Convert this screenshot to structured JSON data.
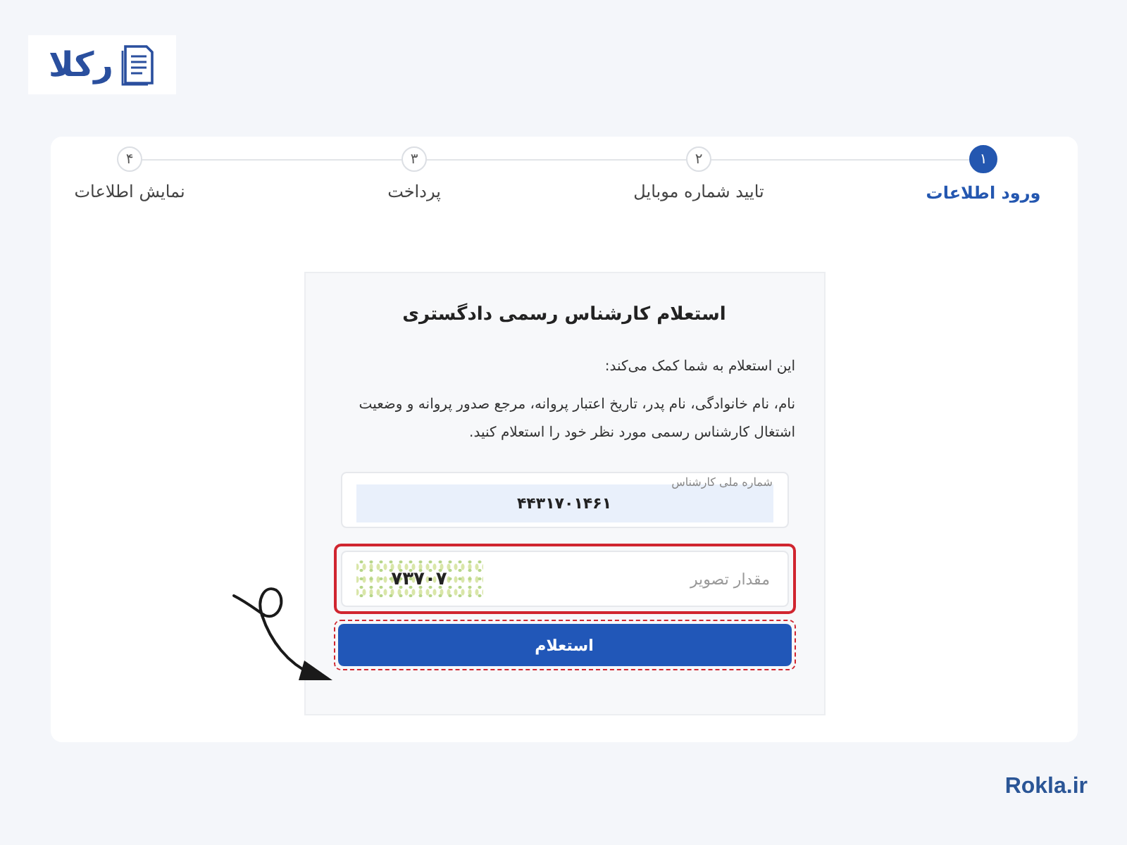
{
  "logo": {
    "text": "رکلا"
  },
  "steps": [
    {
      "number": "۱",
      "label": "ورود اطلاعات",
      "selected": true
    },
    {
      "number": "۲",
      "label": "تایید شماره موبایل",
      "selected": false
    },
    {
      "number": "۳",
      "label": "پرداخت",
      "selected": false
    },
    {
      "number": "۴",
      "label": "نمایش اطلاعات",
      "selected": false
    }
  ],
  "form": {
    "title": "استعلام کارشناس رسمی دادگستری",
    "intro": "این استعلام به شما کمک می‌کند:",
    "description": "نام، نام خانوادگی، نام پدر، تاریخ اعتبار پروانه، مرجع صدور پروانه و وضعیت اشتغال کارشناس رسمی مورد نظر خود را استعلام کنید.",
    "fields": [
      {
        "kind": "text",
        "label": "شماره ملی کارشناس",
        "value": "۴۴۳۱۷۰۱۴۶۱",
        "highlighted": false
      },
      {
        "kind": "captcha",
        "placeholder": "مقدار تصویر",
        "captcha": "۷۳۷۰۷",
        "highlighted": true
      }
    ],
    "submit": {
      "label": "استعلام",
      "highlighted": true
    }
  },
  "footer": {
    "site": "Rokla.ir"
  }
}
